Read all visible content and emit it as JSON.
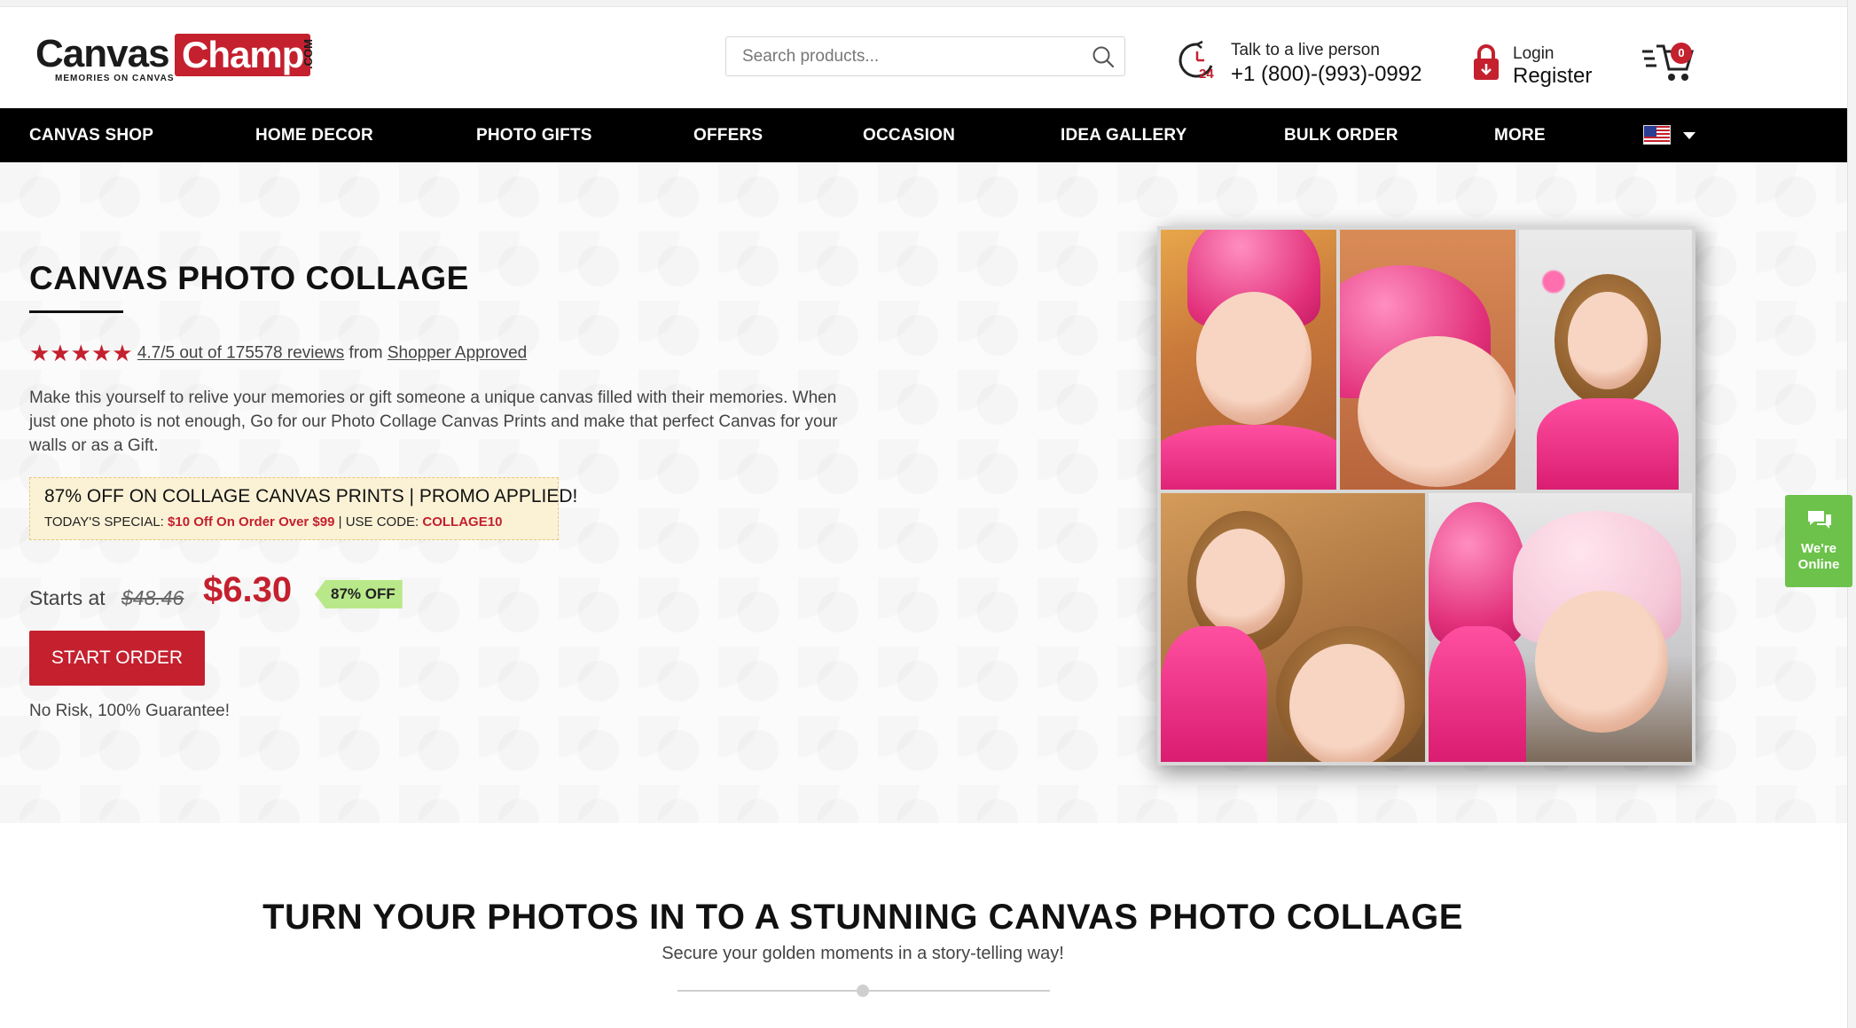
{
  "header": {
    "logo_canvas": "Canvas",
    "logo_champ": "Champ",
    "logo_dotcom": ".COM",
    "logo_tagline": "MEMORIES ON CANVAS",
    "search_placeholder": "Search products...",
    "support_label": "Talk to a live person",
    "support_phone": "+1 (800)-(993)-0992",
    "login_label": "Login",
    "register_label": "Register",
    "cart_count": "0",
    "icons": [
      "search-icon",
      "clock-24-icon",
      "lock-icon",
      "cart-icon"
    ]
  },
  "nav": {
    "items": [
      "CANVAS SHOP",
      "HOME DECOR",
      "PHOTO GIFTS",
      "OFFERS",
      "OCCASION",
      "IDEA GALLERY",
      "BULK ORDER",
      "MORE"
    ],
    "country_flag": "us-flag-icon"
  },
  "hero": {
    "title": "CANVAS PHOTO COLLAGE",
    "stars": "★★★★★",
    "rating_text": "4.7/5 out of 175578 reviews",
    "rating_from": "from",
    "rating_source": "Shopper Approved",
    "description": "Make this yourself to relive your memories or gift someone a unique canvas filled with their memories. When just one photo is not enough, Go for our Photo Collage Canvas Prints and make that perfect Canvas for your walls or as a Gift.",
    "promo_line1": "87% OFF ON COLLAGE CANVAS PRINTS | PROMO APPLIED!",
    "promo_special_label": "TODAY'S SPECIAL:",
    "promo_special_offer": "$10 Off On Order Over $99",
    "promo_code_label": "| USE CODE:",
    "promo_code": "COLLAGE10",
    "starts_at": "Starts at",
    "old_price": "$48.46",
    "new_price": "$6.30",
    "discount_badge": "87% OFF",
    "cta_label": "START ORDER",
    "guarantee": "No Risk, 100% Guarantee!"
  },
  "chat": {
    "line1": "We're",
    "line2": "Online"
  },
  "section": {
    "title": "TURN YOUR PHOTOS IN TO A STUNNING CANVAS PHOTO COLLAGE",
    "subtitle": "Secure your golden moments in a story-telling way!"
  },
  "colors": {
    "brand_red": "#c4202e",
    "nav_bg": "#000000",
    "promo_bg": "#fbf2d6",
    "discount_green": "#b9e88a",
    "chat_green": "#6cc24a"
  }
}
